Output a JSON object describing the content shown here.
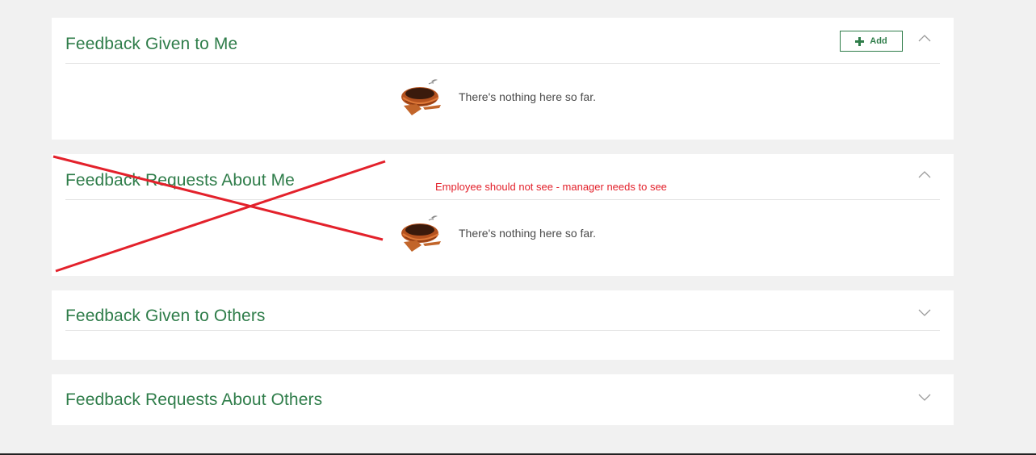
{
  "sections": [
    {
      "title": "Feedback Given to Me",
      "add_label": "Add",
      "expanded": true,
      "empty_message": "There's nothing here so far."
    },
    {
      "title": "Feedback Requests About Me",
      "expanded": true,
      "empty_message": "There's nothing here so far."
    },
    {
      "title": "Feedback Given to Others",
      "expanded": false
    },
    {
      "title": "Feedback Requests About Others",
      "expanded": false
    }
  ],
  "annotation": {
    "text": "Employee should not see - manager needs to see",
    "color": "#e3212b"
  },
  "colors": {
    "accent": "#2f7d4a",
    "background": "#f1f1f1",
    "panel": "#ffffff"
  },
  "icons": {
    "collapse": "chevron-up-icon",
    "expand": "chevron-down-icon",
    "add": "plus-icon",
    "empty": "nest-icon"
  }
}
